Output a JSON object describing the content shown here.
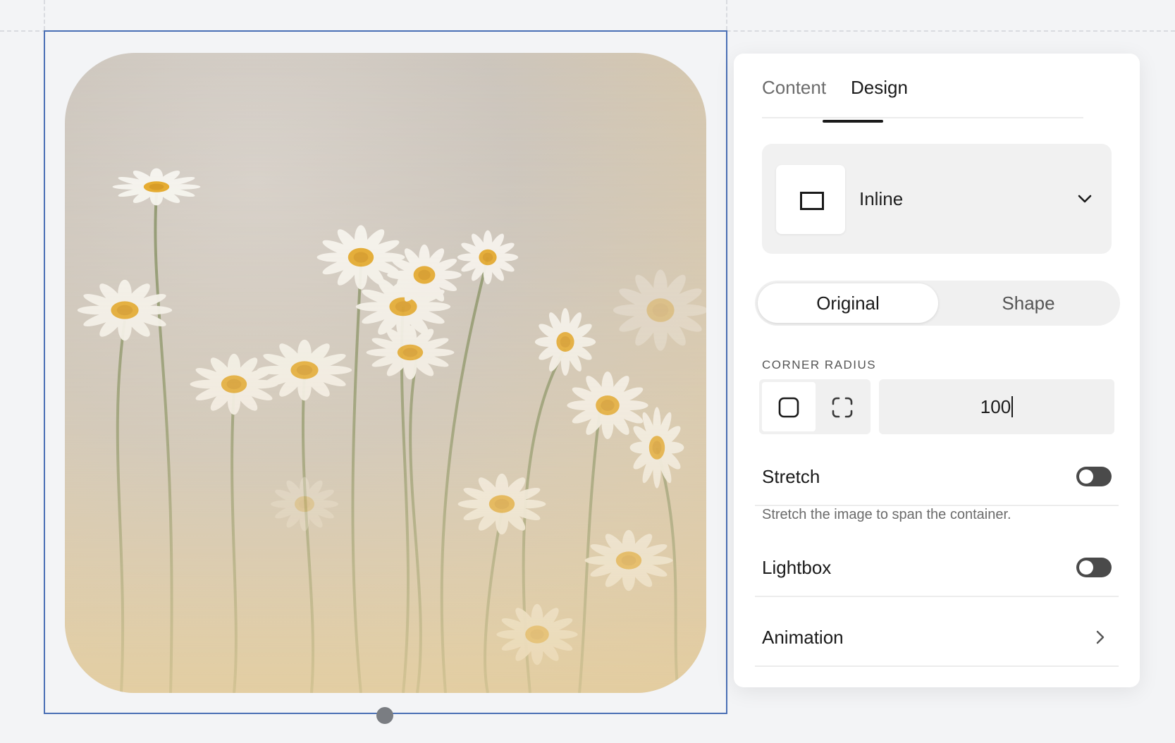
{
  "panel": {
    "tabs": [
      {
        "label": "Content",
        "active": false
      },
      {
        "label": "Design",
        "active": true
      }
    ],
    "layout": {
      "selected": "Inline",
      "icon": "rectangle-icon"
    },
    "image_mode": {
      "options": [
        "Original",
        "Shape"
      ],
      "selected": "Original"
    },
    "corner_radius": {
      "label": "CORNER RADIUS",
      "value": "100"
    },
    "stretch": {
      "label": "Stretch",
      "on": false,
      "help": "Stretch the image to span the container."
    },
    "lightbox": {
      "label": "Lightbox",
      "on": false
    },
    "animation": {
      "label": "Animation"
    }
  },
  "colors": {
    "selection_border": "#4a6fb5",
    "toggle_off": "#4a4a4a",
    "background": "#f3f4f6"
  }
}
